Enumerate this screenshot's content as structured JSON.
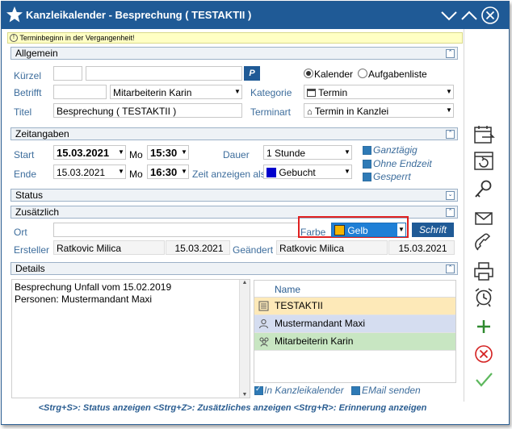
{
  "window": {
    "title": "Kanzleikalender - Besprechung ( TESTAKTII )"
  },
  "warning": "Terminbeginn in der Vergangenheit!",
  "allgemein": {
    "header": "Allgemein",
    "kuerzel_label": "Kürzel",
    "p_button": "P",
    "kalender_label": "Kalender",
    "aufgabenliste_label": "Aufgabenliste",
    "betrifft_label": "Betrifft",
    "betrifft_value": "Mitarbeiterin Karin",
    "kategorie_label": "Kategorie",
    "kategorie_value": "Termin",
    "titel_label": "Titel",
    "titel_value": "Besprechung ( TESTAKTII )",
    "terminart_label": "Terminart",
    "terminart_value": "Termin in Kanzlei"
  },
  "zeitangaben": {
    "header": "Zeitangaben",
    "start_label": "Start",
    "start_date": "15.03.2021",
    "start_day": "Mo",
    "start_time": "15:30",
    "dauer_label": "Dauer",
    "dauer_value": "1 Stunde",
    "ende_label": "Ende",
    "end_date": "15.03.2021",
    "end_day": "Mo",
    "end_time": "16:30",
    "zeit_anzeigen_label": "Zeit anzeigen als",
    "zeit_anzeigen_value": "Gebucht",
    "zeit_color": "#0000cc",
    "ganztaegig": "Ganztägig",
    "ohne_endzeit": "Ohne Endzeit",
    "gesperrt": "Gesperrt"
  },
  "status": {
    "header": "Status"
  },
  "zusaetzlich": {
    "header": "Zusätzlich",
    "ort_label": "Ort",
    "farbe_label": "Farbe",
    "farbe_value": "Gelb",
    "farbe_swatch": "#f5b400",
    "schrift_button": "Schrift",
    "ersteller_label": "Ersteller",
    "ersteller_value": "Ratkovic Milica",
    "ersteller_date": "15.03.2021",
    "geaendert_label": "Geändert",
    "geaendert_value": "Ratkovic Milica",
    "geaendert_date": "15.03.2021"
  },
  "details": {
    "header": "Details",
    "text_line1": "Besprechung Unfall vom 15.02.2019",
    "text_line2": "Personen: Mustermandant Maxi",
    "grid_header": "Name",
    "rows": [
      {
        "name": "TESTAKTII",
        "color": "#fde9b8",
        "icon": "file-icon"
      },
      {
        "name": "Mustermandant Maxi",
        "color": "#d5ddf0",
        "icon": "person-icon"
      },
      {
        "name": "Mitarbeiterin Karin",
        "color": "#c8e6c2",
        "icon": "group-icon"
      }
    ],
    "in_kanzleikalender": "In Kanzleikalender",
    "email_senden": "EMail senden"
  },
  "statusbar": "<Strg+S>: Status anzeigen <Strg+Z>: Zusätzliches anzeigen <Strg+R>: Erinnerung anzeigen",
  "colors": {
    "title_bar": "#1f5a96",
    "label_blue": "#3d6d9c",
    "highlight_red": "#e02020"
  }
}
